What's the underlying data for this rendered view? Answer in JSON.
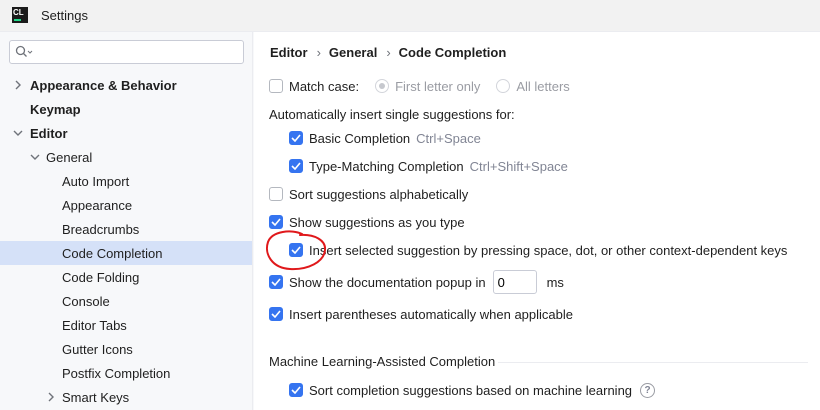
{
  "window": {
    "logo_text": "CL",
    "title": "Settings"
  },
  "sidebar": {
    "search": {
      "value": "",
      "placeholder": ""
    },
    "items": [
      {
        "label": "Appearance & Behavior",
        "bold": true,
        "arrow": "collapsed"
      },
      {
        "label": "Keymap",
        "bold": true
      },
      {
        "label": "Editor",
        "bold": true,
        "arrow": "expanded"
      },
      {
        "label": "General",
        "arrow": "expanded"
      },
      {
        "label": "Auto Import"
      },
      {
        "label": "Appearance"
      },
      {
        "label": "Breadcrumbs"
      },
      {
        "label": "Code Completion",
        "selected": true
      },
      {
        "label": "Code Folding"
      },
      {
        "label": "Console"
      },
      {
        "label": "Editor Tabs"
      },
      {
        "label": "Gutter Icons"
      },
      {
        "label": "Postfix Completion"
      },
      {
        "label": "Smart Keys",
        "arrow": "collapsed"
      }
    ]
  },
  "breadcrumb": [
    "Editor",
    "General",
    "Code Completion"
  ],
  "options": {
    "match_case": {
      "label": "Match case:",
      "checked": false
    },
    "first_letter_only": {
      "label": "First letter only",
      "selected": true,
      "disabled": true
    },
    "all_letters": {
      "label": "All letters",
      "selected": false,
      "disabled": true
    },
    "auto_insert_heading": "Automatically insert single suggestions for:",
    "basic_completion": {
      "label": "Basic Completion",
      "shortcut": "Ctrl+Space",
      "checked": true
    },
    "type_matching": {
      "label": "Type-Matching Completion",
      "shortcut": "Ctrl+Shift+Space",
      "checked": true
    },
    "sort_alpha": {
      "label": "Sort suggestions alphabetically",
      "checked": false
    },
    "show_as_type": {
      "label": "Show suggestions as you type",
      "checked": true
    },
    "insert_selected": {
      "label": "Insert selected suggestion by pressing space, dot, or other context-dependent keys",
      "checked": true
    },
    "doc_popup": {
      "label": "Show the documentation popup in",
      "checked": true,
      "value": "0",
      "unit": "ms"
    },
    "insert_parens": {
      "label": "Insert parentheses automatically when applicable",
      "checked": true
    },
    "ml_section_title": "Machine Learning-Assisted Completion",
    "sort_ml": {
      "label": "Sort completion suggestions based on machine learning",
      "checked": true
    }
  },
  "colors": {
    "accent": "#3574f0",
    "selection": "#d5e1f8",
    "annotation": "#e0181b"
  }
}
